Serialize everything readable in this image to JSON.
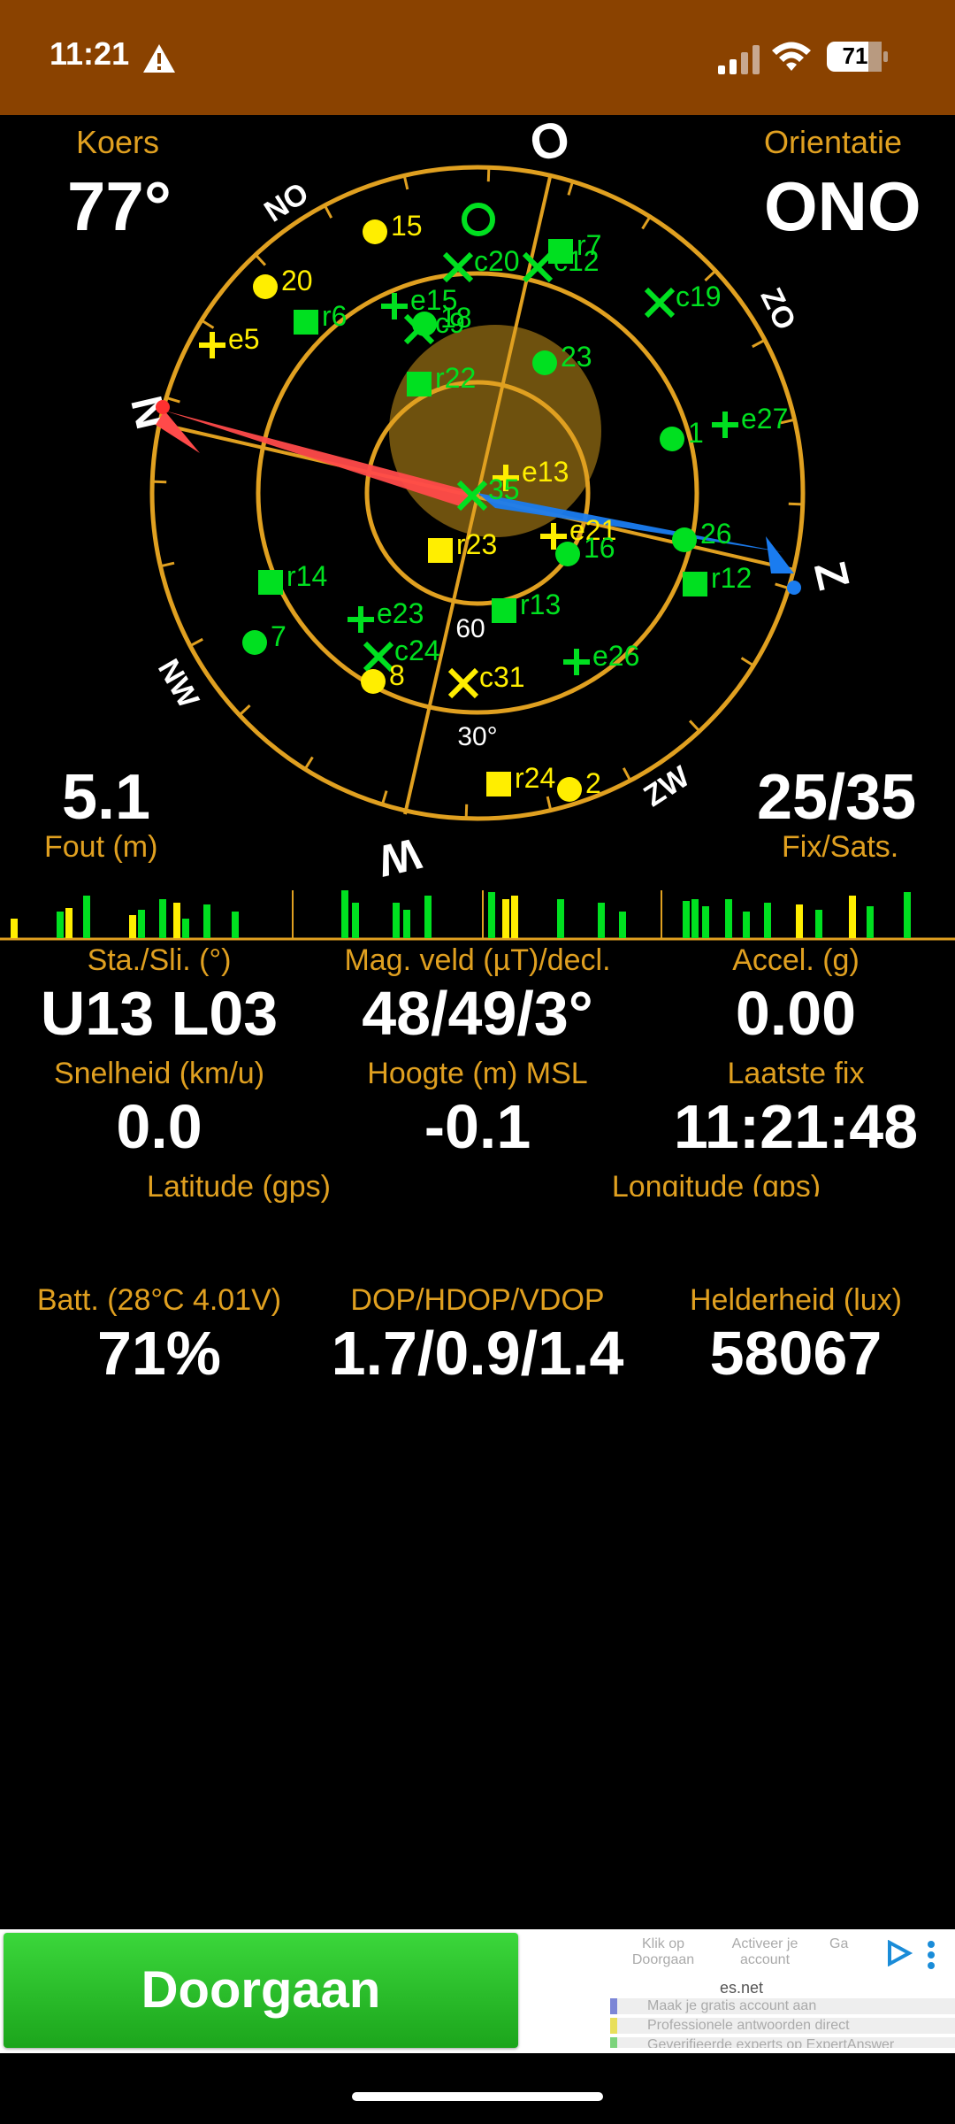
{
  "status_bar": {
    "time": "11:21",
    "battery": "71"
  },
  "header": {
    "koers_label": "Koers",
    "koers_value": "77°",
    "orientatie_label": "Orientatie",
    "orientatie_value": "ONO"
  },
  "compass": {
    "dirs": [
      "O",
      "ZO",
      "Z",
      "ZW",
      "W",
      "NW",
      "N",
      "NO"
    ],
    "ring_labels": [
      "60",
      "30°"
    ]
  },
  "satellites": [
    {
      "id": "15",
      "type": "circle",
      "color": "yellow"
    },
    {
      "id": "20",
      "type": "circle",
      "color": "yellow"
    },
    {
      "id": "e5",
      "type": "plus",
      "color": "yellow"
    },
    {
      "id": "c20",
      "type": "x",
      "color": "green"
    },
    {
      "id": "r7",
      "type": "square",
      "color": "green"
    },
    {
      "id": "c12",
      "type": "x",
      "color": "green"
    },
    {
      "id": "c19",
      "type": "x",
      "color": "green"
    },
    {
      "id": "r6",
      "type": "square",
      "color": "green"
    },
    {
      "id": "e15",
      "type": "plus",
      "color": "green"
    },
    {
      "id": "18",
      "type": "circle",
      "color": "green"
    },
    {
      "id": "c9",
      "type": "x",
      "color": "green"
    },
    {
      "id": "23",
      "type": "circle",
      "color": "green"
    },
    {
      "id": "r22",
      "type": "square",
      "color": "green"
    },
    {
      "id": "1",
      "type": "circle",
      "color": "green"
    },
    {
      "id": "e27",
      "type": "plus",
      "color": "green"
    },
    {
      "id": "e13",
      "type": "plus",
      "color": "yellow"
    },
    {
      "id": "35",
      "type": "x",
      "color": "green"
    },
    {
      "id": "r23",
      "type": "square",
      "color": "yellow"
    },
    {
      "id": "e21",
      "type": "plus",
      "color": "yellow"
    },
    {
      "id": "16",
      "type": "circle",
      "color": "green"
    },
    {
      "id": "26",
      "type": "circle",
      "color": "green"
    },
    {
      "id": "r12",
      "type": "square",
      "color": "green"
    },
    {
      "id": "r14",
      "type": "square",
      "color": "green"
    },
    {
      "id": "r13",
      "type": "square",
      "color": "green"
    },
    {
      "id": "7",
      "type": "circle",
      "color": "green"
    },
    {
      "id": "e23",
      "type": "plus",
      "color": "green"
    },
    {
      "id": "c24",
      "type": "x",
      "color": "green"
    },
    {
      "id": "8",
      "type": "circle",
      "color": "yellow"
    },
    {
      "id": "c31",
      "type": "x",
      "color": "yellow"
    },
    {
      "id": "e26",
      "type": "plus",
      "color": "green"
    },
    {
      "id": "r24",
      "type": "square",
      "color": "yellow"
    },
    {
      "id": "2",
      "type": "circle",
      "color": "yellow"
    }
  ],
  "stats": {
    "fout_value": "5.1",
    "fout_label": "Fout (m)",
    "fix_value": "25/35",
    "fix_label": "Fix/Sats."
  },
  "data_grid": [
    {
      "label": "Sta./Sli. (°)",
      "value": "U13 L03"
    },
    {
      "label": "Mag. veld (µT)/decl.",
      "value": "48/49/3°"
    },
    {
      "label": "Accel. (g)",
      "value": "0.00"
    },
    {
      "label": "Snelheid (km/u)",
      "value": "0.0"
    },
    {
      "label": "Hoogte (m) MSL",
      "value": "-0.1"
    },
    {
      "label": "Laatste fix",
      "value": "11:21:48"
    },
    {
      "label": "Latitude (gps)",
      "value": ""
    },
    {
      "label": "Longitude (gps)",
      "value": ""
    },
    {
      "label": "Batt. (28°C 4.01V)",
      "value": "71%"
    },
    {
      "label": "DOP/HDOP/VDOP",
      "value": "1.7/0.9/1.4"
    },
    {
      "label": "Helderheid (lux)",
      "value": "58067"
    }
  ],
  "bottom_bar": {
    "button_label": "Doorgaan",
    "ad_steps": [
      "Klik op Doorgaan",
      "Activeer je account",
      "Ga"
    ],
    "ad_domain": "es.net",
    "ad_items": [
      "Maak je gratis account aan",
      "Professionele antwoorden direct",
      "Geverifieerde experts op ExpertAnswer"
    ]
  },
  "colors": {
    "accent": "#e0a020",
    "status_bar": "#8a4200",
    "green": "#00e020",
    "yellow": "#ffee00",
    "button": "#22b822"
  }
}
